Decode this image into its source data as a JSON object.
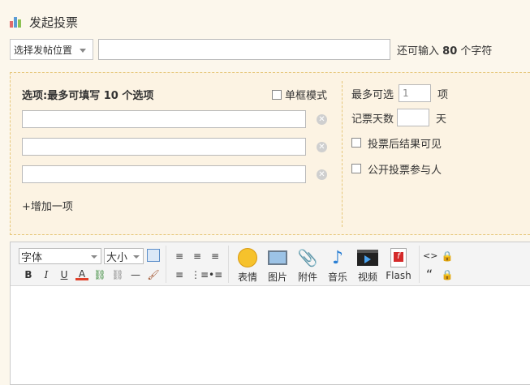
{
  "header": {
    "title": "发起投票",
    "icon": "bar-chart-icon"
  },
  "subject": {
    "position_select": "选择发帖位置",
    "input_value": "",
    "counter_prefix": "还可输入",
    "counter_number": "80",
    "counter_suffix": "个字符"
  },
  "options": {
    "title": "选项:最多可填写 10 个选项",
    "single_mode_label": "单框模式",
    "items": [
      "",
      "",
      ""
    ],
    "add_label": "+增加一项"
  },
  "settings": {
    "max_choice_label": "最多可选",
    "max_choice_value": "1",
    "max_choice_unit": "项",
    "days_label": "记票天数",
    "days_value": "",
    "days_unit": "天",
    "visible_after_label": "投票后结果可见",
    "public_voters_label": "公开投票参与人"
  },
  "editor": {
    "font_select": "字体",
    "size_select": "大小",
    "buttons": {
      "emoji": "表情",
      "image": "图片",
      "attachment": "附件",
      "music": "音乐",
      "video": "视频",
      "flash": "Flash"
    },
    "format": {
      "bold": "B",
      "italic": "I",
      "underline": "U",
      "font_color": "A",
      "hr": "—",
      "code": "<>",
      "quote": "“"
    }
  },
  "colors": {
    "background": "#fcf7ec",
    "panel": "#fcf3e3",
    "border_dashed": "#e6c77a"
  }
}
